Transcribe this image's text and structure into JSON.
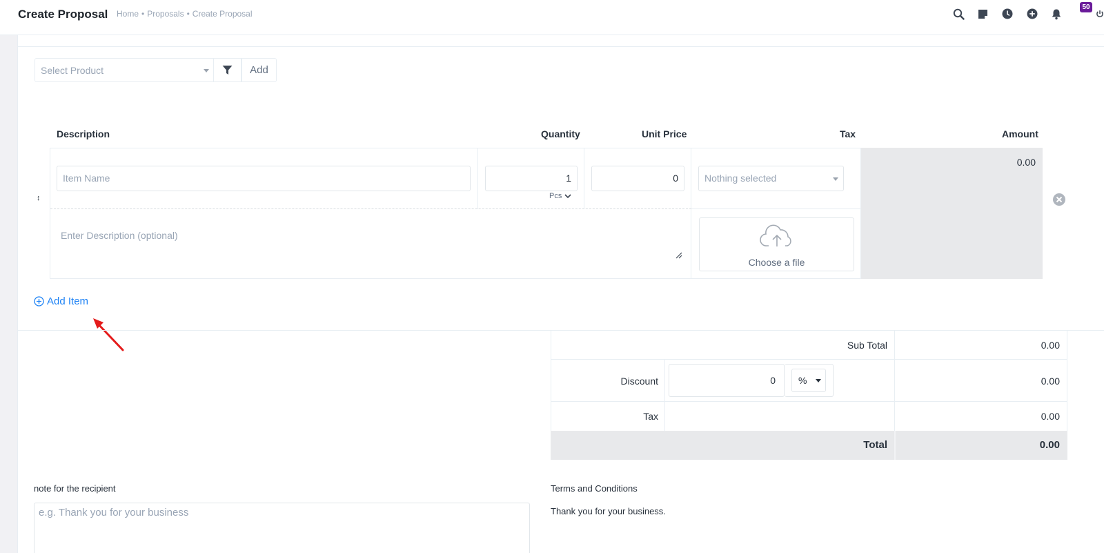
{
  "header": {
    "title": "Create Proposal",
    "breadcrumb": [
      "Home",
      "Proposals",
      "Create Proposal"
    ],
    "notification_count": "50",
    "icons": [
      "search-icon",
      "sticky-note-icon",
      "clock-icon",
      "plus-circle-icon",
      "bell-icon",
      "power-icon"
    ]
  },
  "product_picker": {
    "placeholder": "Select Product",
    "add_label": "Add"
  },
  "table": {
    "headers": {
      "description": "Description",
      "quantity": "Quantity",
      "unit_price": "Unit Price",
      "tax": "Tax",
      "amount": "Amount"
    },
    "item": {
      "name_placeholder": "Item Name",
      "quantity": "1",
      "unit": "Pcs",
      "unit_price": "0",
      "tax_placeholder": "Nothing selected",
      "description_placeholder": "Enter Description (optional)",
      "upload_label": "Choose a file",
      "amount": "0.00"
    },
    "add_item_label": "Add Item"
  },
  "totals": {
    "sub_total_label": "Sub Total",
    "sub_total": "0.00",
    "discount_label": "Discount",
    "discount_value": "0",
    "discount_type": "%",
    "discount_amount": "0.00",
    "tax_label": "Tax",
    "tax_amount": "0.00",
    "total_label": "Total",
    "total": "0.00"
  },
  "notes": {
    "label": "note for the recipient",
    "placeholder": "e.g. Thank you for your business"
  },
  "terms": {
    "label": "Terms and Conditions",
    "text": "Thank you for your business."
  },
  "colors": {
    "accent": "#1d82f5",
    "badge": "#6a1b9a",
    "annotation_arrow": "#e41b1b"
  }
}
